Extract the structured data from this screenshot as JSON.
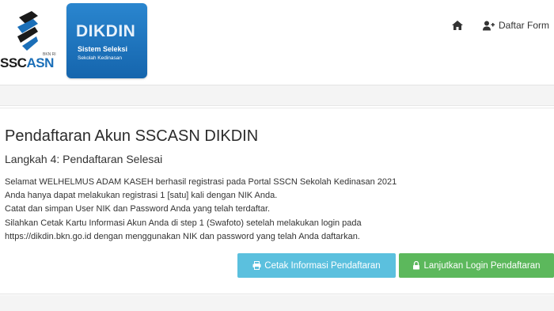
{
  "header": {
    "sscasn_logo": {
      "text_main": "SSC",
      "text_accent": "ASN",
      "tagline": "BKN RI"
    },
    "dikdin_logo": {
      "title": "DIKDIN",
      "subtitle": "Sistem Seleksi",
      "subsubtitle": "Sekolah Kedinasan"
    },
    "nav": {
      "home_icon": "home-icon",
      "daftar_label": "Daftar Form"
    }
  },
  "main": {
    "title": "Pendaftaran Akun SSCASN DIKDIN",
    "subtitle": "Langkah 4: Pendaftaran Selesai",
    "lines": [
      "Selamat WELHELMUS ADAM KASEH berhasil registrasi pada Portal SSCN Sekolah Kedinasan 2021",
      "Anda hanya dapat melakukan registrasi 1 [satu] kali dengan NIK Anda.",
      "Catat dan simpan User NIK dan Password Anda yang telah terdaftar.",
      "Silahkan Cetak Kartu Informasi Akun Anda di step 1 (Swafoto) setelah melakukan login pada",
      "https://dikdin.bkn.go.id dengan menggunakan NIK dan password yang telah Anda daftarkan."
    ],
    "buttons": {
      "cetak_label": "Cetak Informasi Pendaftaran",
      "lanjut_label": "Lanjutkan Login Pendaftaran"
    }
  },
  "colors": {
    "info_button": "#5bc0de",
    "success_button": "#5cb85c",
    "dikdin_blue": "#1b6fb8"
  }
}
